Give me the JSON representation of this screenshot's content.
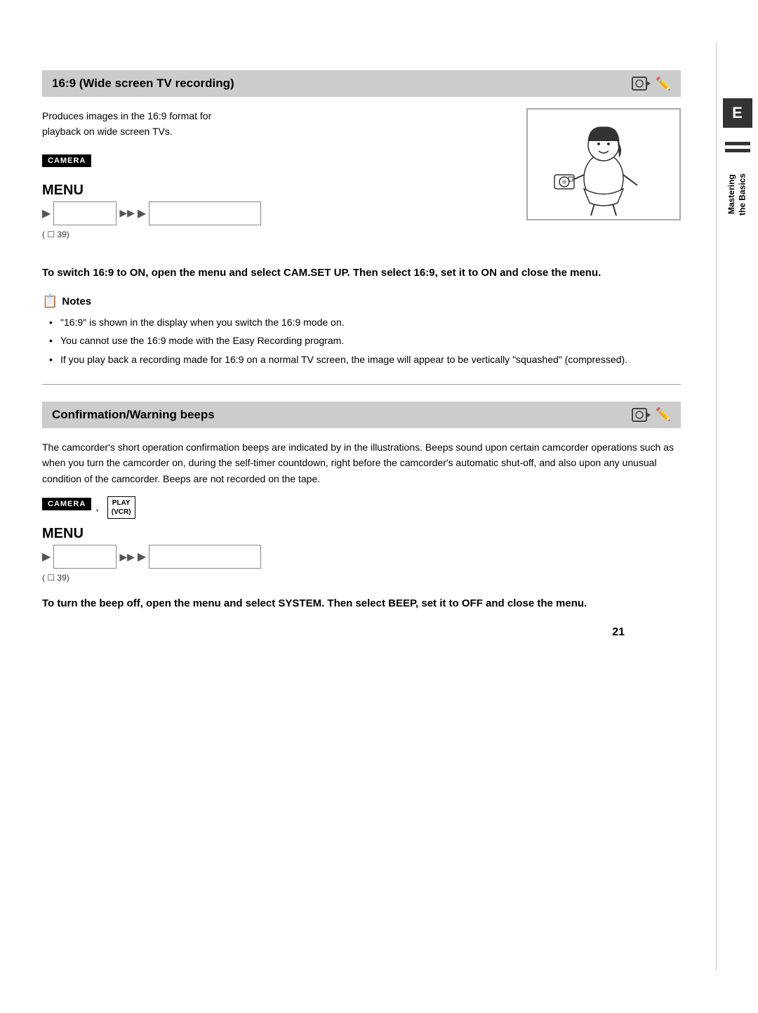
{
  "page": {
    "number": "21",
    "sidebar": {
      "tab_label": "E",
      "mastering_text": "Mastering\nthe Basics"
    }
  },
  "section1": {
    "title": "16:9 (Wide screen TV recording)",
    "description_line1": "Produces images in the 16:9 format for",
    "description_line2": "playback on wide screen TVs.",
    "camera_badge": "CAMERA",
    "menu_label": "MENU",
    "menu_flow": {
      "arrow1": "▶",
      "double_arrow": "▶▶",
      "arrow2": "▶"
    },
    "page_ref": "( ☐ 39)",
    "instruction": "To switch 16:9 to ON, open the menu and select CAM.SET UP. Then select 16:9, set it to ON and close the menu.",
    "notes_header": "Notes",
    "notes": [
      "\"16:9\" is shown in the display when you switch the 16:9 mode on.",
      "You cannot use the 16:9 mode with the Easy Recording program.",
      "If you play back a recording made for 16:9 on a normal TV screen, the image will appear to be vertically \"squashed\" (compressed)."
    ]
  },
  "section2": {
    "title": "Confirmation/Warning beeps",
    "description": "The camcorder's short operation confirmation beeps are indicated by    in the illustrations. Beeps sound upon certain camcorder operations such as when you turn the camcorder on, during the self-timer countdown, right before the camcorder's automatic shut-off, and also upon any unusual condition of the camcorder. Beeps are not recorded on the tape.",
    "camera_badge": "CAMERA",
    "play_vcr_badge_line1": "PLAY",
    "play_vcr_badge_line2": "(VCR)",
    "comma": ",",
    "menu_label": "MENU",
    "menu_flow": {
      "arrow1": "▶",
      "double_arrow": "▶▶",
      "arrow2": "▶"
    },
    "page_ref": "( ☐ 39)",
    "instruction": "To turn the beep off, open the menu and select SYSTEM. Then select BEEP, set it to OFF and close the menu."
  }
}
